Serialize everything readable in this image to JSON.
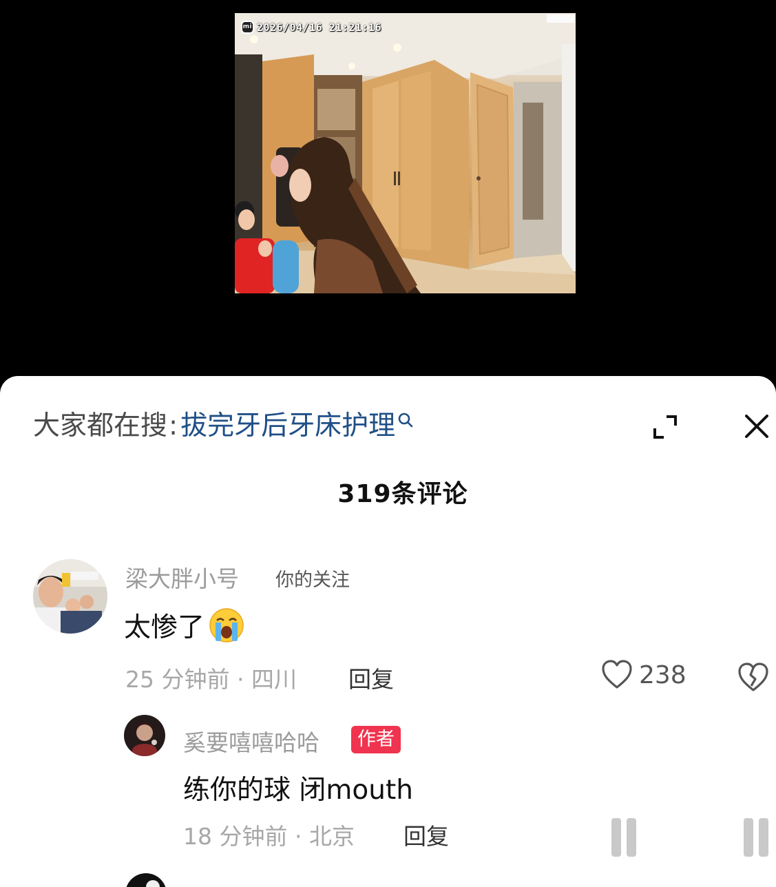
{
  "video": {
    "timestamp": "2026/04/16  21:21:16",
    "camera_logo": "mi"
  },
  "sheet": {
    "search_prefix": "大家都在搜",
    "search_separator": ":",
    "search_term": "拔完牙后牙床护理",
    "comment_count": "319条评论",
    "icons": {
      "search": "search-icon",
      "expand": "expand-icon",
      "close": "close-icon"
    }
  },
  "comments": [
    {
      "username": "梁大胖小号",
      "tag": "你的关注",
      "text": "太惨了",
      "emoji": "crying-face-emoji",
      "meta": "25 分钟前 · 四川",
      "reply_label": "回复",
      "likes": "238"
    },
    {
      "username": "奚要嘻嘻哈哈",
      "tag": "作者",
      "text": "练你的球 闭mouth",
      "meta": "18 分钟前 · 北京",
      "reply_label": "回复"
    }
  ],
  "colors": {
    "search_term": "#1f4f86",
    "author_badge": "#f0334e",
    "sheet_bg": "#ffffff",
    "video_bg": "#000000"
  }
}
